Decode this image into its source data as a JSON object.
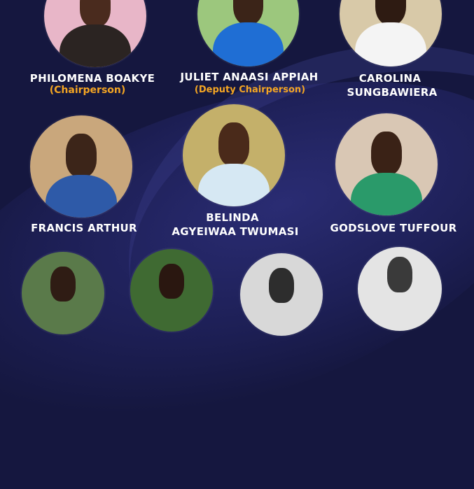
{
  "members": [
    {
      "name_line1": "PHILOMENA BOAKYE",
      "role": "(Chairperson)"
    },
    {
      "name_line1": "JULIET ANAASI APPIAH",
      "role": "(Deputy Chairperson)"
    },
    {
      "name_line1": "CAROLINA",
      "name_line2": "SUNGBAWIERA"
    },
    {
      "name_line1": "FRANCIS ARTHUR"
    },
    {
      "name_line1": "BELINDA",
      "name_line2": "AGYEIWAA TWUMASI"
    },
    {
      "name_line1": "GODSLOVE TUFFOUR"
    }
  ],
  "colors": {
    "background": "#15173f",
    "name_text": "#ffffff",
    "role_text": "#f5a623"
  }
}
